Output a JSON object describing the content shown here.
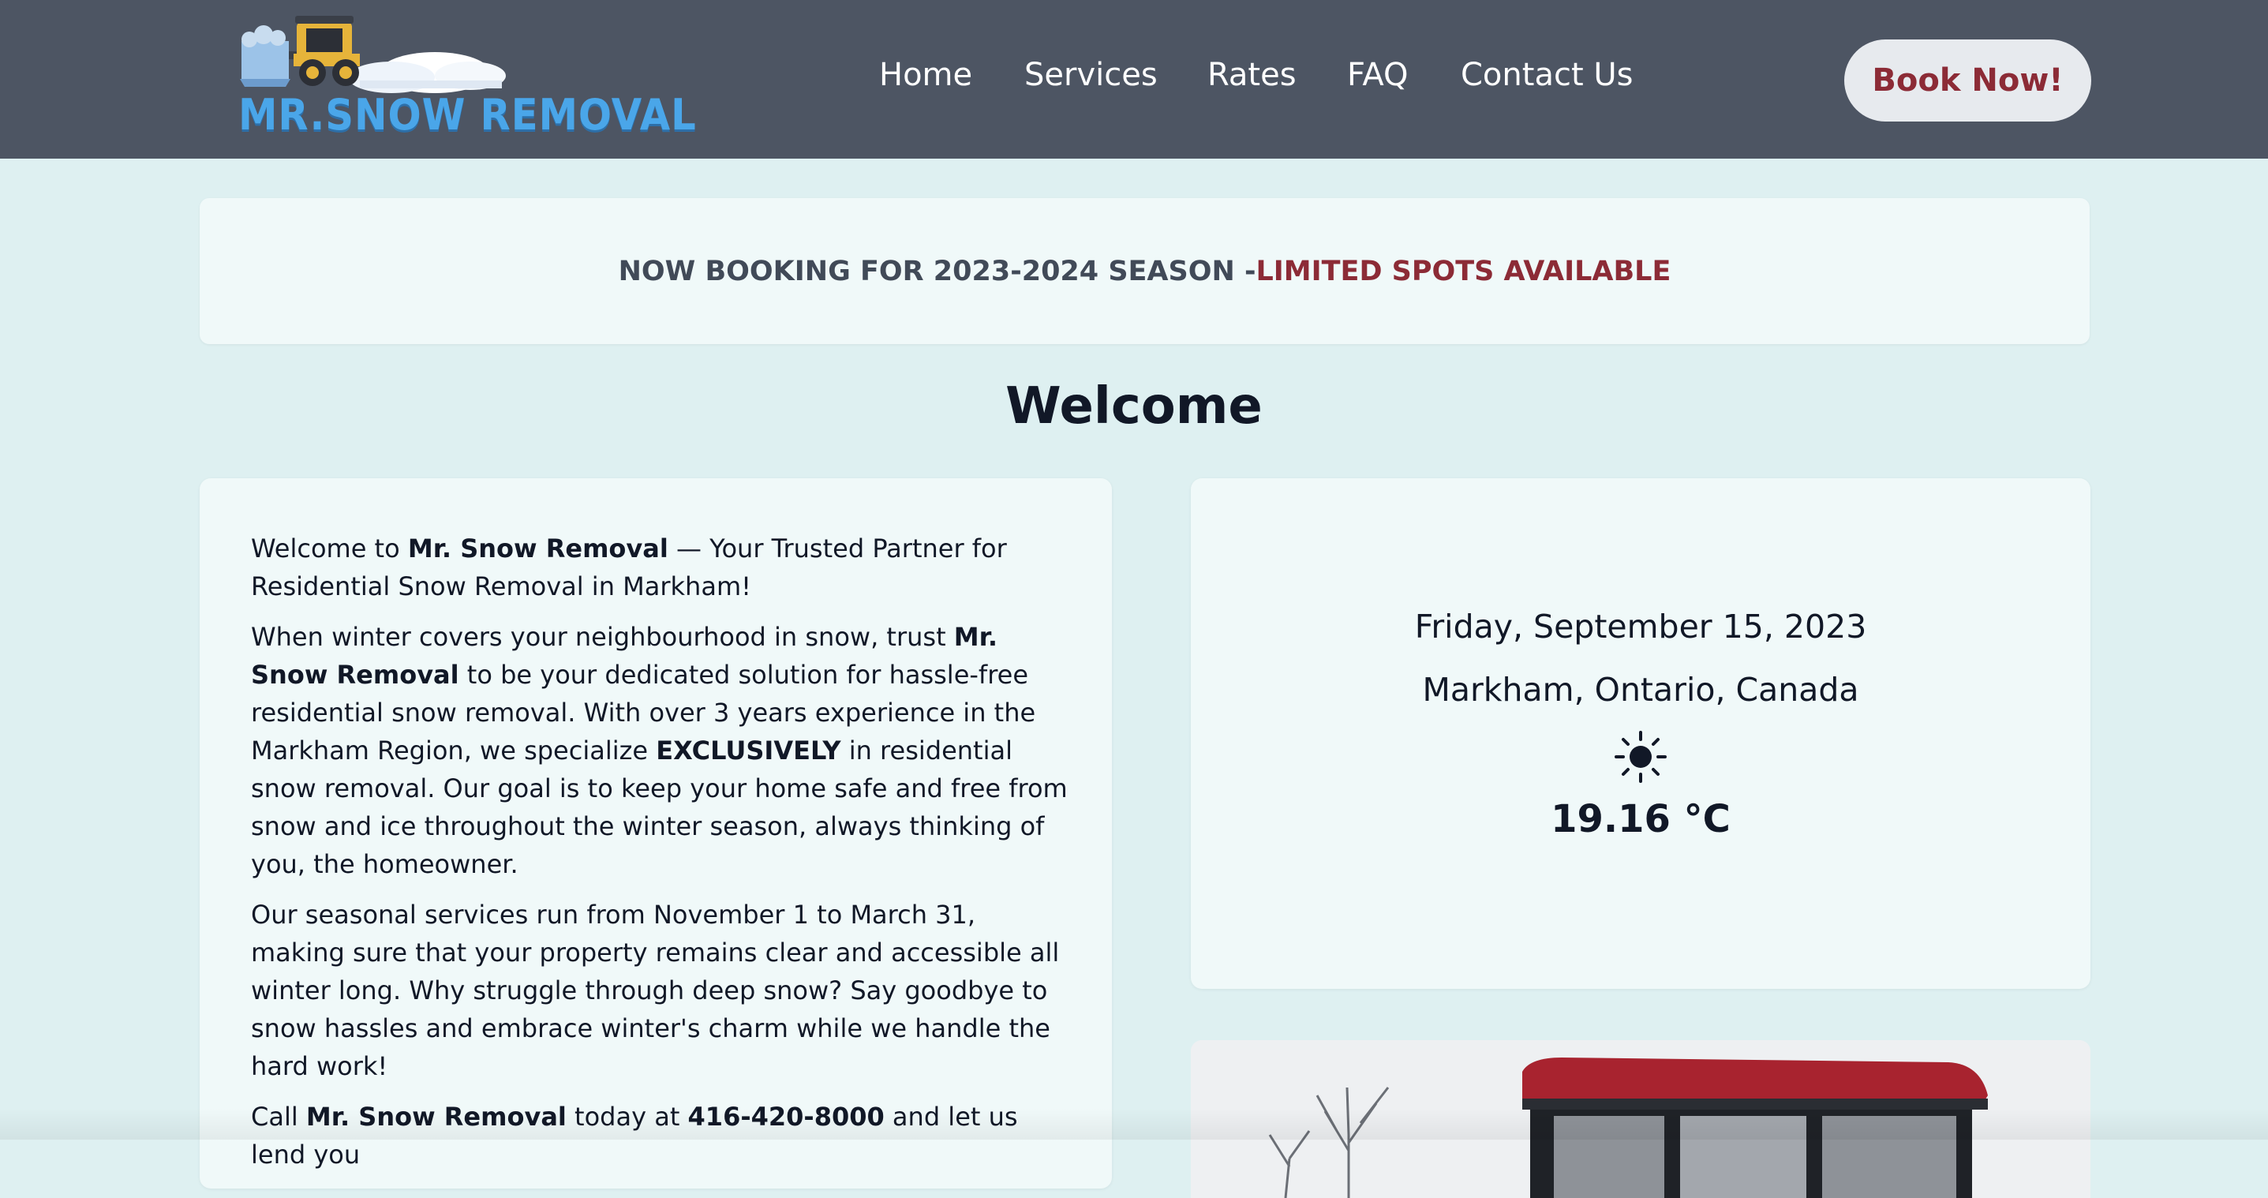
{
  "header": {
    "logo_text": "MR.SNOW REMOVAL",
    "nav": [
      {
        "label": "Home"
      },
      {
        "label": "Services"
      },
      {
        "label": "Rates"
      },
      {
        "label": "FAQ"
      },
      {
        "label": "Contact Us"
      }
    ],
    "book_button": "Book Now!"
  },
  "banner": {
    "part1": "NOW BOOKING FOR 2023-2024 SEASON -",
    "part2": "LIMITED SPOTS AVAILABLE"
  },
  "welcome": {
    "title": "Welcome",
    "p1": {
      "a": "Welcome to ",
      "b": "Mr. Snow Removal",
      "c": " — Your Trusted Partner for Residential Snow Removal in Markham!"
    },
    "p2": {
      "a": "When winter covers your neighbourhood in snow, trust ",
      "b": "Mr. Snow Removal",
      "c": " to be your dedicated solution for hassle-free residential snow removal. With over 3 years experience in the Markham Region, we specialize ",
      "d": "EXCLUSIVELY",
      "e": " in residential snow removal. Our goal is to keep your home safe and free from snow and ice throughout the winter season, always thinking of you, the homeowner."
    },
    "p3": "Our seasonal services run from November 1 to March 31, making sure that your property remains clear and accessible all winter long. Why struggle through deep snow? Say goodbye to snow hassles and embrace winter's charm while we handle the hard work!",
    "p4": {
      "a": "Call ",
      "b": "Mr. Snow Removal",
      "c": " today at ",
      "d": "416-420-8000",
      "e": " and let us lend you"
    }
  },
  "weather": {
    "date": "Friday, September 15, 2023",
    "location": "Markham, Ontario, Canada",
    "icon": "sun-icon",
    "temperature": "19.16 °C"
  },
  "colors": {
    "header_bg": "#4d5563",
    "page_bg": "#def0f1",
    "card_bg": "#f0f9f9",
    "accent": "#8c2b36",
    "logo_blue": "#4aa6e9"
  }
}
